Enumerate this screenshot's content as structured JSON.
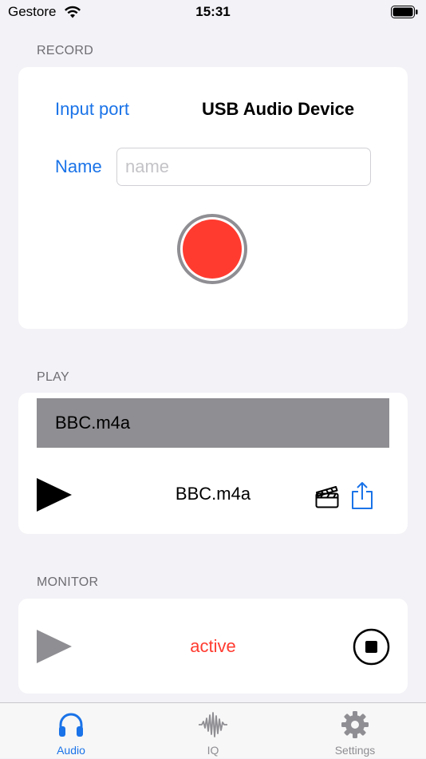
{
  "status_bar": {
    "carrier": "Gestore",
    "time": "15:31"
  },
  "record": {
    "header": "RECORD",
    "input_port_label": "Input port",
    "input_port_value": "USB Audio Device",
    "name_label": "Name",
    "name_value": "",
    "name_placeholder": "name"
  },
  "play": {
    "header": "PLAY",
    "files": [
      "BBC.m4a"
    ],
    "now_playing": "BBC.m4a"
  },
  "monitor": {
    "header": "MONITOR",
    "status": "active"
  },
  "tabs": [
    {
      "label": "Audio",
      "icon": "headphones-icon",
      "selected": true
    },
    {
      "label": "IQ",
      "icon": "waveform-icon",
      "selected": false
    },
    {
      "label": "Settings",
      "icon": "gear-icon",
      "selected": false
    }
  ],
  "colors": {
    "accent": "#1a73e8",
    "record": "#ff3b30",
    "active_status": "#ff3b30",
    "selected_row": "#8e8e93",
    "tab_inactive": "#8e8e93"
  }
}
